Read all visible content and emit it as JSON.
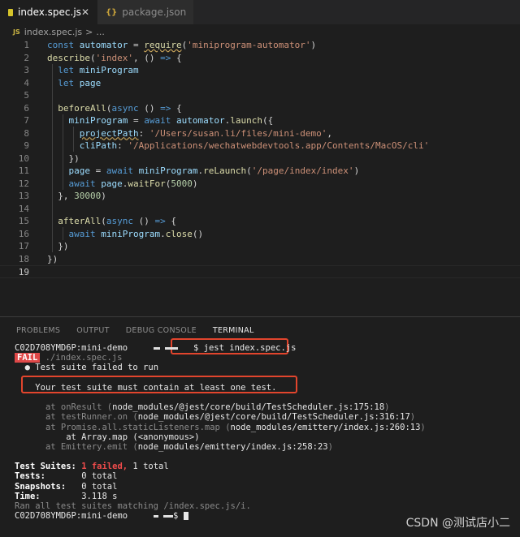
{
  "tabs": [
    {
      "label": "index.spec.js",
      "close": "✕"
    },
    {
      "label": "package.json"
    }
  ],
  "breadcrumb": {
    "file": "index.spec.js",
    "sep": ">",
    "tail": "..."
  },
  "editor": {
    "lines": [
      {
        "n": "1"
      },
      {
        "n": "2"
      },
      {
        "n": "3"
      },
      {
        "n": "4"
      },
      {
        "n": "5"
      },
      {
        "n": "6"
      },
      {
        "n": "7"
      },
      {
        "n": "8"
      },
      {
        "n": "9"
      },
      {
        "n": "10"
      },
      {
        "n": "11"
      },
      {
        "n": "12"
      },
      {
        "n": "13"
      },
      {
        "n": "14"
      },
      {
        "n": "15"
      },
      {
        "n": "16"
      },
      {
        "n": "17"
      },
      {
        "n": "18"
      },
      {
        "n": "19"
      }
    ]
  },
  "panel": {
    "tabs": [
      "PROBLEMS",
      "OUTPUT",
      "DEBUG CONSOLE",
      "TERMINAL"
    ],
    "active_tab": "TERMINAL"
  },
  "terminal": {
    "prompt1": "C02D708YMD6P:mini-demo",
    "prompt1_tail": "$",
    "command": "jest index.spec.js",
    "fail_badge": "FAIL",
    "fail_file": "./index.spec.js",
    "bullet_line": "● Test suite failed to run",
    "error_msg": "Your test suite must contain at least one test.",
    "stack": [
      {
        "prefix": "at onResult (",
        "path": "node_modules/@jest/core/build/TestScheduler.js:175:18",
        "suffix": ")"
      },
      {
        "prefix": "at testRunner.on (",
        "path": "node_modules/@jest/core/build/TestScheduler.js:316:17",
        "suffix": ")"
      },
      {
        "prefix": "at Promise.all.staticListeners.map (",
        "path": "node_modules/emittery/index.js:260:13",
        "suffix": ")"
      },
      {
        "prefix": "at Array.map (<anonymous>)",
        "path": "",
        "suffix": ""
      },
      {
        "prefix": "at Emittery.emit (",
        "path": "node_modules/emittery/index.js:258:23",
        "suffix": ")"
      }
    ],
    "summary": {
      "suites_label": "Test Suites:",
      "suites_failed": "1 failed,",
      "suites_total": "1 total",
      "tests_label": "Tests:",
      "tests_value": "0 total",
      "snap_label": "Snapshots:",
      "snap_value": "0 total",
      "time_label": "Time:",
      "time_value": "3.118 s",
      "ran_line": "Ran all test suites matching /index.spec.js/i."
    },
    "prompt2": "C02D708YMD6P:mini-demo",
    "prompt2_tail": "$"
  },
  "watermark": "CSDN @测试店小二",
  "colors": {
    "keyword": "#569cd6",
    "variable": "#9cdcfe",
    "function": "#dcdcaa",
    "string": "#ce9178",
    "fail": "#e04848",
    "highlight_box": "#e2452d"
  }
}
